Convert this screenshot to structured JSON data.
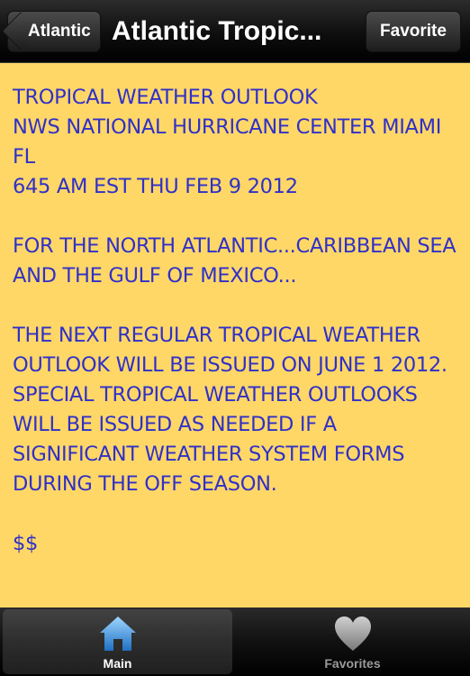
{
  "navbar": {
    "back_label": "Atlantic",
    "title": "Atlantic Tropic...",
    "favorite_label": "Favorite"
  },
  "content": {
    "paragraphs": [
      "TROPICAL WEATHER OUTLOOK\nNWS NATIONAL HURRICANE CENTER MIAMI FL\n645 AM EST THU FEB 9 2012",
      "FOR THE NORTH ATLANTIC...CARIBBEAN SEA AND THE GULF OF MEXICO...",
      "THE NEXT REGULAR TROPICAL WEATHER OUTLOOK WILL BE ISSUED ON JUNE 1 2012. SPECIAL TROPICAL WEATHER OUTLOOKS WILL BE ISSUED AS NEEDED IF A SIGNIFICANT WEATHER SYSTEM FORMS DURING THE OFF SEASON.",
      "$$"
    ]
  },
  "tabbar": {
    "tabs": [
      {
        "label": "Main",
        "icon": "home-icon",
        "selected": true
      },
      {
        "label": "Favorites",
        "icon": "heart-icon",
        "selected": false
      }
    ]
  },
  "colors": {
    "content_background": "#fed767",
    "text": "#3030c8",
    "tab_icon_selected": "#3b8fd8"
  }
}
